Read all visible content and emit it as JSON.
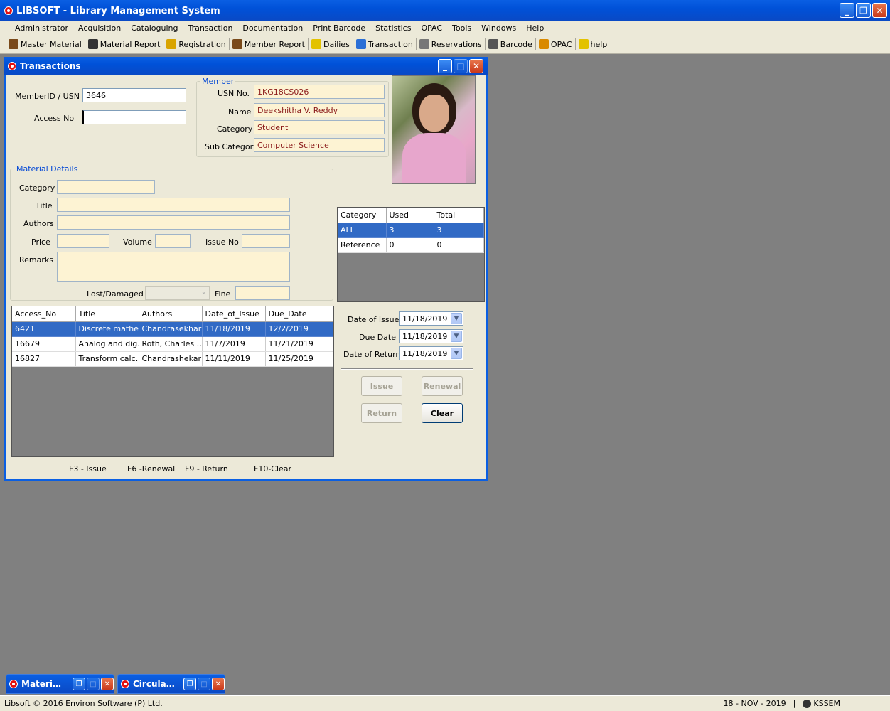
{
  "app": {
    "title": "LIBSOFT - Library Management System"
  },
  "menu": [
    "Administrator",
    "Acquisition",
    "Cataloguing",
    "Transaction",
    "Documentation",
    "Print Barcode",
    "Statistics",
    "OPAC",
    "Tools",
    "Windows",
    "Help"
  ],
  "toolbar": [
    {
      "label": "Master Material",
      "icon": "books-icon",
      "color": "#7a4a1a"
    },
    {
      "label": "Material Report",
      "icon": "binoculars-icon",
      "color": "#333"
    },
    {
      "label": "Registration",
      "icon": "users-icon",
      "color": "#d9a400"
    },
    {
      "label": "Member Report",
      "icon": "people-icon",
      "color": "#7a4a1a"
    },
    {
      "label": "Dailies",
      "icon": "list-icon",
      "color": "#e3c200"
    },
    {
      "label": "Transaction",
      "icon": "check-icon",
      "color": "#2a6fd6"
    },
    {
      "label": "Reservations",
      "icon": "calendar-icon",
      "color": "#777"
    },
    {
      "label": "Barcode",
      "icon": "barcode-icon",
      "color": "#555"
    },
    {
      "label": "OPAC",
      "icon": "network-icon",
      "color": "#d98a00"
    },
    {
      "label": "help",
      "icon": "help-icon",
      "color": "#e3c200"
    }
  ],
  "window": {
    "title": "Transactions"
  },
  "form": {
    "member_id_label": "MemberID / USN",
    "member_id_value": "3646",
    "access_no_label": "Access No",
    "access_no_value": ""
  },
  "member": {
    "group_title": "Member",
    "usn_label": "USN No.",
    "usn_value": "1KG18CS026",
    "name_label": "Name",
    "name_value": "Deekshitha V. Reddy",
    "category_label": "Category",
    "category_value": "Student",
    "subcategory_label": "Sub Category",
    "subcategory_value": "Computer Science"
  },
  "material": {
    "group_title": "Material Details",
    "category_label": "Category",
    "title_label": "Title",
    "authors_label": "Authors",
    "price_label": "Price",
    "volume_label": "Volume",
    "issue_no_label": "Issue No",
    "remarks_label": "Remarks",
    "lost_label": "Lost/Damaged",
    "fine_label": "Fine"
  },
  "usage": {
    "headers": [
      "Category",
      "Used",
      "Total"
    ],
    "rows": [
      [
        "ALL",
        "3",
        "3"
      ],
      [
        "Reference",
        "0",
        "0"
      ]
    ]
  },
  "issued": {
    "headers": [
      "Access_No",
      "Title",
      "Authors",
      "Date_of_Issue",
      "Due_Date"
    ],
    "rows": [
      [
        "6421",
        "Discrete mathe…",
        "Chandrasekhar…",
        "11/18/2019",
        "12/2/2019"
      ],
      [
        "16679",
        "Analog and dig…",
        "Roth, Charles …",
        "11/7/2019",
        "11/21/2019"
      ],
      [
        "16827",
        "Transform calc…",
        "Chandrashekar…",
        "11/11/2019",
        "11/25/2019"
      ]
    ]
  },
  "dates": {
    "issue_label": "Date of Issue",
    "issue_value": "11/18/2019",
    "due_label": "Due Date",
    "due_value": "11/18/2019",
    "return_label": "Date of Return",
    "return_value": "11/18/2019"
  },
  "buttons": {
    "issue": "Issue",
    "renewal": "Renewal",
    "return": "Return",
    "clear": "Clear"
  },
  "shortcuts": {
    "issue": "F3 - Issue",
    "renewal": "F6 -Renewal",
    "return": "F9 - Return",
    "clear": "F10-Clear"
  },
  "taskbar": [
    {
      "label": "Materi…"
    },
    {
      "label": "Circula…"
    }
  ],
  "status": {
    "copyright": "Libsoft © 2016 Environ Software (P) Ltd.",
    "date": "18 - NOV - 2019",
    "user": "KSSEM"
  }
}
